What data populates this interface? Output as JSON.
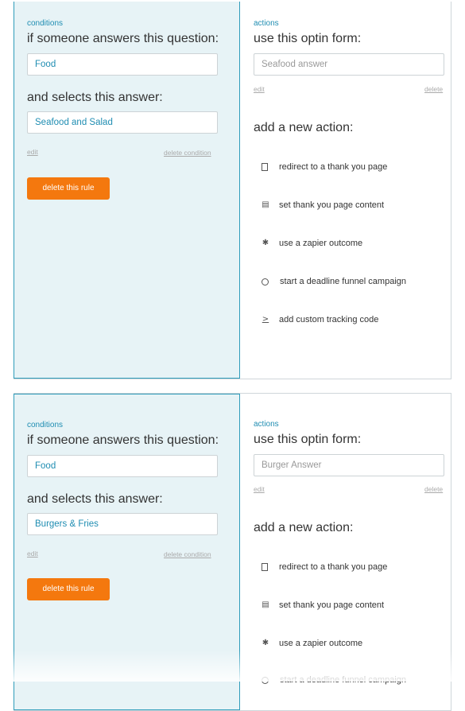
{
  "rules": [
    {
      "conditions": {
        "label": "conditions",
        "question_heading": "if someone answers this question:",
        "question_value": "Food",
        "answer_heading": "and selects this answer:",
        "answer_value": "Seafood and Salad",
        "edit_label": "edit",
        "delete_condition_label": "delete condition",
        "delete_rule_label": "delete this rule"
      },
      "actions": {
        "label": "actions",
        "form_heading": "use this optin form:",
        "form_value": "Seafood answer",
        "edit_label": "edit",
        "delete_label": "delete",
        "add_heading": "add a new action:",
        "items": [
          {
            "label": "redirect to a thank you page",
            "icon": "page-icon"
          },
          {
            "label": "set thank you page content",
            "icon": "content-icon"
          },
          {
            "label": "use a zapier outcome",
            "icon": "gear-icon"
          },
          {
            "label": "start a deadline funnel campaign",
            "icon": "clock-icon"
          },
          {
            "label": "add custom tracking code",
            "icon": "code-icon"
          }
        ]
      }
    },
    {
      "conditions": {
        "label": "conditions",
        "question_heading": "if someone answers this question:",
        "question_value": "Food",
        "answer_heading": "and selects this answer:",
        "answer_value": "Burgers & Fries",
        "edit_label": "edit",
        "delete_condition_label": "delete condition",
        "delete_rule_label": "delete this rule"
      },
      "actions": {
        "label": "actions",
        "form_heading": "use this optin form:",
        "form_value": "Burger Answer",
        "edit_label": "edit",
        "delete_label": "delete",
        "add_heading": "add a new action:",
        "items": [
          {
            "label": "redirect to a thank you page",
            "icon": "page-icon"
          },
          {
            "label": "set thank you page content",
            "icon": "content-icon"
          },
          {
            "label": "use a zapier outcome",
            "icon": "gear-icon"
          },
          {
            "label": "start a deadline funnel campaign",
            "icon": "clock-icon"
          }
        ]
      }
    }
  ],
  "colors": {
    "accent": "#1f8db2",
    "condition_bg": "#e7f3f6",
    "condition_border": "#2f9cba",
    "delete_button": "#f4780e"
  }
}
